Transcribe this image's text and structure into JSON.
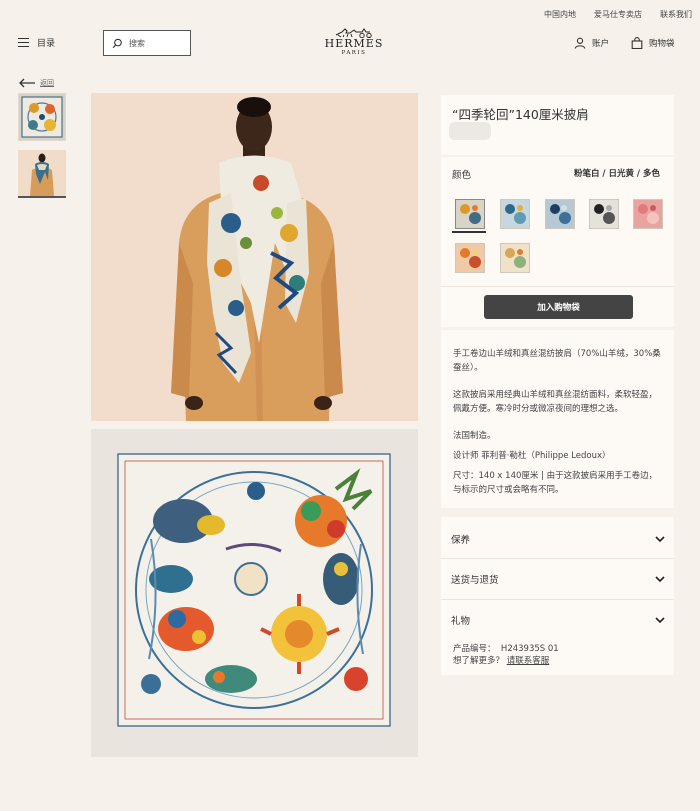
{
  "header": {
    "top_links": [
      "中国内地",
      "爱马仕专卖店",
      "联系我们"
    ],
    "menu_label": "目录",
    "search_placeholder": "搜索",
    "logo_brand": "HERMÈS",
    "logo_city": "PARIS",
    "account_label": "账户",
    "cart_label": "购物袋"
  },
  "nav": {
    "back_label": "返回"
  },
  "product": {
    "title": "“四季轮回”140厘米披肩",
    "color_label": "颜色",
    "color_value": "粉笔白 / 日光黄 / 多色",
    "swatch_count_selected_index": 0,
    "add_to_cart_label": "加入购物袋",
    "description": [
      "手工卷边山羊绒和真丝混纺披肩（70%山羊绒，30%桑蚕丝）。",
      "这款披肩采用经典山羊绒和真丝混纺面料，柔软轻盈，佩戴方便。寒冷时分或微凉夜间的理想之选。",
      "法国制造。",
      "设计师 菲利普·勒杜（Philippe Ledoux）",
      "尺寸：140 x 140厘米 | 由于这款披肩采用手工卷边，与标示的尺寸或会略有不同。"
    ],
    "accordions": [
      "保养",
      "送货与退货",
      "礼物"
    ],
    "ref_label": "产品编号：",
    "ref_value": "H243935S 01",
    "help_prefix": "想了解更多？",
    "help_link": "请联系客服"
  },
  "colors": {
    "background": "#f6f1eb",
    "panel": "#fdfaf6",
    "button": "#444444"
  }
}
